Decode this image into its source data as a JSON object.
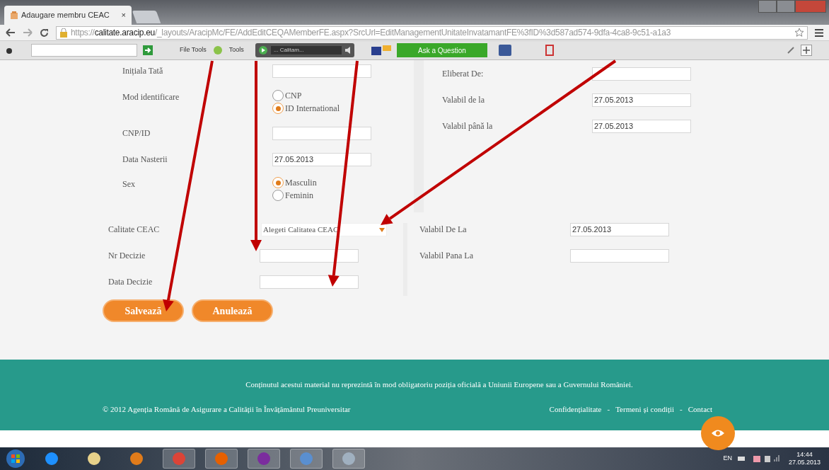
{
  "browser": {
    "tab_title": "Adaugare membru CEAC",
    "tab_close": "×",
    "url_scheme": "https://",
    "url_domain": "calitate.aracip.eu",
    "url_path": "/_layouts/AracipMc/FE/AddEditCEQAMemberFE.aspx?SrcUrl=EditManagementUnitateInvatamantFE%3fID%3d587ad574-9dfa-4ca8-9c51-a1a3"
  },
  "toolbar": {
    "file_tools": "File Tools",
    "tools": "Tools",
    "media_title": "... Calitam...",
    "ask_button": "Ask a Question"
  },
  "left_fields": [
    {
      "kind": "text",
      "label": "Inițiala Tată"
    },
    {
      "kind": "radio",
      "label": "Mod identificare",
      "options": [
        {
          "label": "CNP",
          "selected": false
        },
        {
          "label": "ID International",
          "selected": true
        }
      ]
    },
    {
      "kind": "text",
      "label": "CNP/ID"
    },
    {
      "kind": "text",
      "label": "Data Nasterii",
      "value": "27.05.2013"
    },
    {
      "kind": "radio",
      "label": "Sex",
      "options": [
        {
          "label": "Masculin",
          "selected": true
        },
        {
          "label": "Feminin",
          "selected": false
        }
      ]
    }
  ],
  "right_fields": [
    {
      "label": "Eliberat De:"
    },
    {
      "label": "Valabil de la",
      "value": "27.05.2013"
    },
    {
      "label": "Valabil până la",
      "value": "27.05.2013"
    }
  ],
  "lower_left_fields": [
    {
      "kind": "select",
      "label": "Calitate CEAC",
      "value": "Alegeti Calitatea CEAC"
    },
    {
      "kind": "text",
      "label": "Nr Decizie"
    },
    {
      "kind": "text",
      "label": "Data Decizie"
    }
  ],
  "lower_right_fields": [
    {
      "label": "Valabil De La",
      "value": "27.05.2013"
    },
    {
      "label": "Valabil Pana La"
    }
  ],
  "buttons": [
    "Salvează",
    "Anulează"
  ],
  "footer": {
    "disclaimer": "Conținutul acestui material nu reprezintă în mod obligatoriu poziția oficială a Uniunii Europene sau a Guvernului României.",
    "copyright": "© 2012 Agenția Română de Asigurare a Calității în Învățământul Preuniversitar",
    "links": [
      "Confidențialitate",
      "Termeni și condiții",
      "Contact"
    ],
    "separator": "-"
  },
  "taskbar": {
    "language": "EN",
    "time": "14:44",
    "date": "27.05.2013"
  }
}
